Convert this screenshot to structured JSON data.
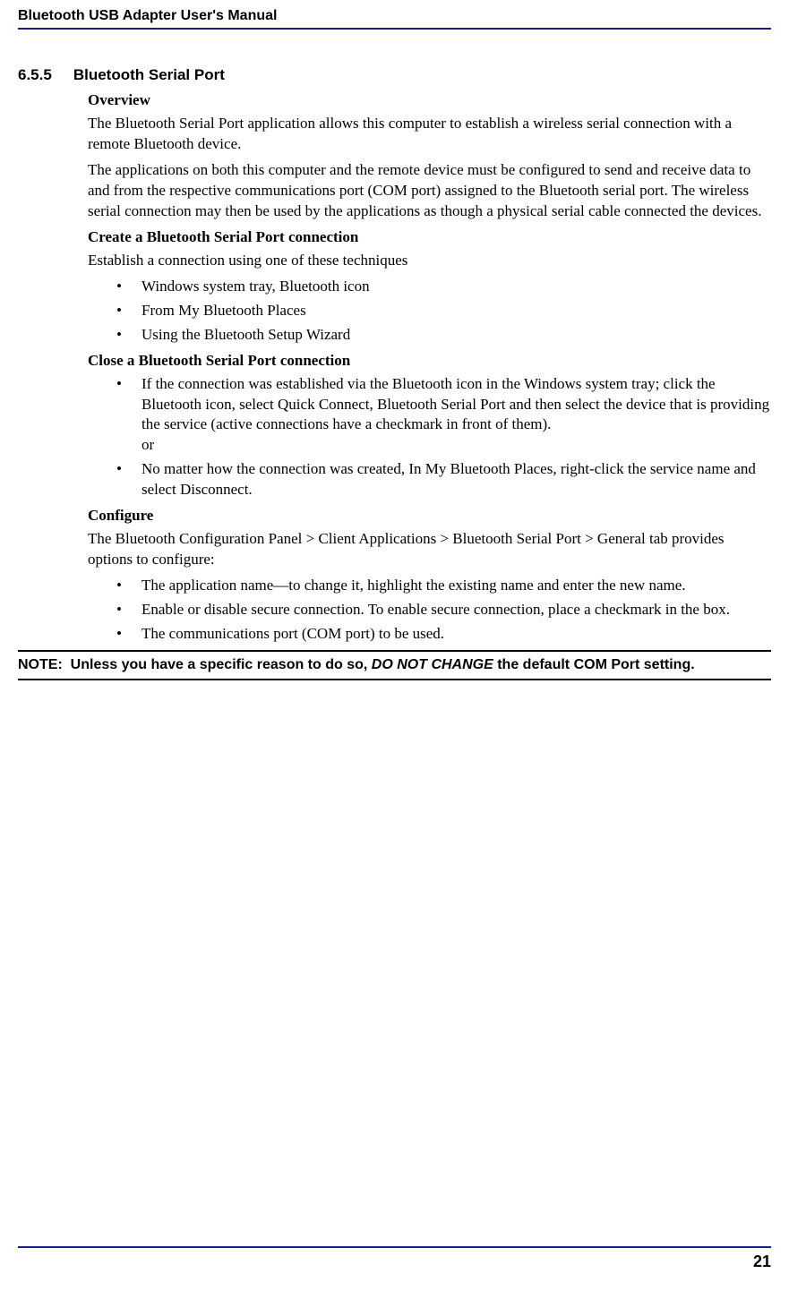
{
  "header": {
    "title": "Bluetooth USB Adapter User's Manual"
  },
  "section": {
    "number": "6.5.5",
    "title": "Bluetooth Serial Port"
  },
  "overview": {
    "heading": "Overview",
    "p1": "The Bluetooth Serial Port application allows this computer to establish a wireless serial connection with a remote Bluetooth device.",
    "p2": "The applications on both this computer and the remote device must be configured to send and receive data to and from the respective communications port (COM port) assigned to the Bluetooth serial port. The wireless serial connection may then be used by the applications as though a physical serial cable connected the devices."
  },
  "create": {
    "heading": "Create a Bluetooth Serial Port connection",
    "intro": "Establish a connection using one of these techniques",
    "items": [
      "Windows system tray, Bluetooth icon",
      "From My Bluetooth Places",
      "Using the Bluetooth Setup Wizard"
    ]
  },
  "close": {
    "heading": "Close a Bluetooth Serial Port connection",
    "items": [
      "If the connection was established via the Bluetooth icon in the Windows system tray; click the Bluetooth icon, select Quick Connect, Bluetooth Serial Port and then select the device that is providing the service (active connections have a checkmark in front of them).\nor",
      "No matter how the connection was created, In My Bluetooth Places, right-click the service name and select Disconnect."
    ]
  },
  "configure": {
    "heading": "Configure",
    "intro": "The Bluetooth Configuration Panel > Client Applications > Bluetooth Serial Port > General tab provides options to configure:",
    "items": [
      "The application name—to change it, highlight the existing name and enter the new name.",
      "Enable or disable secure connection. To enable secure connection, place a checkmark in the box.",
      "The communications port (COM port) to be used."
    ]
  },
  "note": {
    "label": "NOTE:",
    "prefix": "Unless you have a specific reason to do so, ",
    "emphasis": "DO NOT CHANGE",
    "suffix": " the default COM Port setting."
  },
  "footer": {
    "page": "21"
  }
}
